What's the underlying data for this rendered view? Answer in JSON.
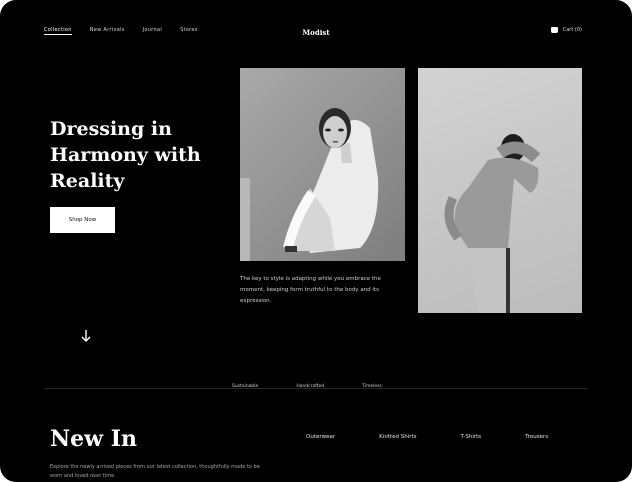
{
  "header": {
    "nav": [
      "Collection",
      "New Arrivals",
      "Journal",
      "Stores"
    ],
    "logo": "Modist",
    "cart_label": "Cart (0)"
  },
  "hero": {
    "title": "Dressing in Harmony with Reality",
    "cta_label": "Shop Now",
    "scroll_icon": "arrow-down-icon",
    "caption": "The key to style is adapting while you embrace the moment, keeping form truthful to the body and its expression."
  },
  "features": [
    "Sustainable",
    "Handcrafted",
    "Timeless"
  ],
  "new_in": {
    "title": "New In",
    "categories": [
      "Outerwear",
      "Knitted Shirts",
      "T-Shirts",
      "Trousers"
    ],
    "description": "Explore the newly arrived pieces from our latest collection, thoughtfully made to be worn and loved over time."
  },
  "colors": {
    "background": "#000000",
    "text": "#ffffff",
    "button": "#ffffff"
  }
}
